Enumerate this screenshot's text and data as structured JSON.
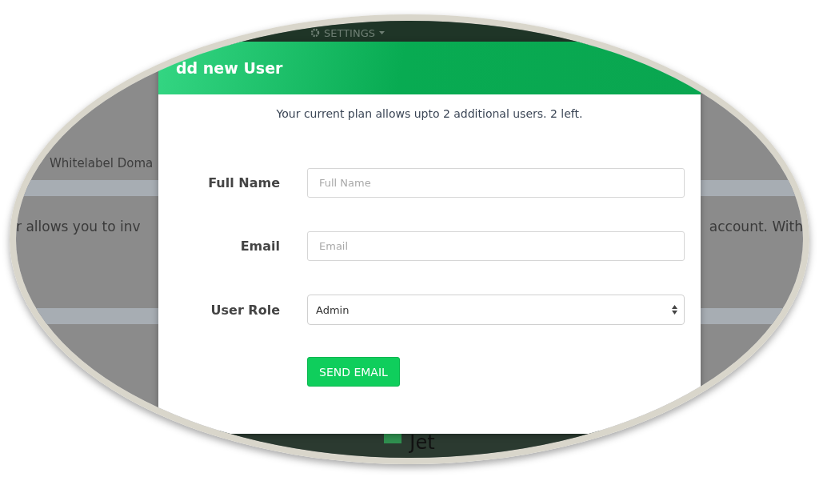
{
  "navbar": {
    "settings": "SETTINGS"
  },
  "background": {
    "tab": "Whitelabel Doma",
    "text_left": "r allows you to inv",
    "text_right": "account. With",
    "logo": "Jet"
  },
  "modal": {
    "title": "dd new User",
    "notice": "Your current plan allows upto 2 additional users. 2 left.",
    "fields": [
      {
        "kind": "text",
        "label": "Full Name",
        "placeholder": "Full Name"
      },
      {
        "kind": "text",
        "label": "Email",
        "placeholder": "Email"
      },
      {
        "kind": "select",
        "label": "User Role",
        "value": "Admin"
      }
    ],
    "button": "SEND EMAIL"
  }
}
